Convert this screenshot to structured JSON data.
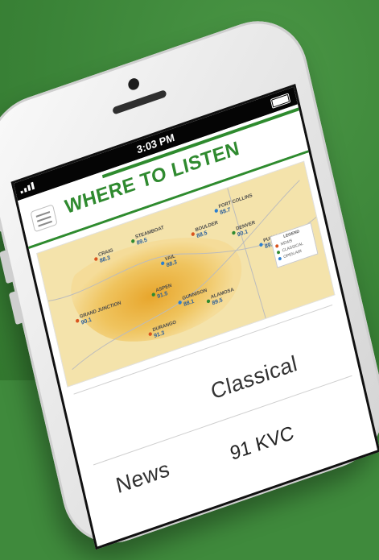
{
  "status_bar": {
    "time": "3:03 PM"
  },
  "header": {
    "title": "WHERE TO LISTEN"
  },
  "map": {
    "stations": [
      {
        "place": "CRAIG",
        "freq": "88.3"
      },
      {
        "place": "STEAMBOAT",
        "freq": "89.5"
      },
      {
        "place": "FORT COLLINS",
        "freq": "88.7"
      },
      {
        "place": "BOULDER",
        "freq": "88.5"
      },
      {
        "place": "DENVER",
        "freq": "90.1"
      },
      {
        "place": "VAIL",
        "freq": "88.3"
      },
      {
        "place": "GRAND JUNCTION",
        "freq": "90.1"
      },
      {
        "place": "ASPEN",
        "freq": "91.5"
      },
      {
        "place": "PUEBLO",
        "freq": "89.1"
      },
      {
        "place": "DURANGO",
        "freq": "91.3"
      },
      {
        "place": "ALAMOSA",
        "freq": "89.5"
      },
      {
        "place": "GUNNISON",
        "freq": "88.1"
      }
    ],
    "legend": {
      "title": "LEGEND",
      "items": [
        "NEWS",
        "CLASSICAL",
        "OPEN AIR"
      ],
      "colors": [
        "#d9541e",
        "#2f8a2f",
        "#2c7fd0"
      ]
    }
  },
  "tabs": [
    {
      "label": "Classical"
    },
    {
      "label": "News"
    }
  ],
  "peek_text": "91 KVC"
}
